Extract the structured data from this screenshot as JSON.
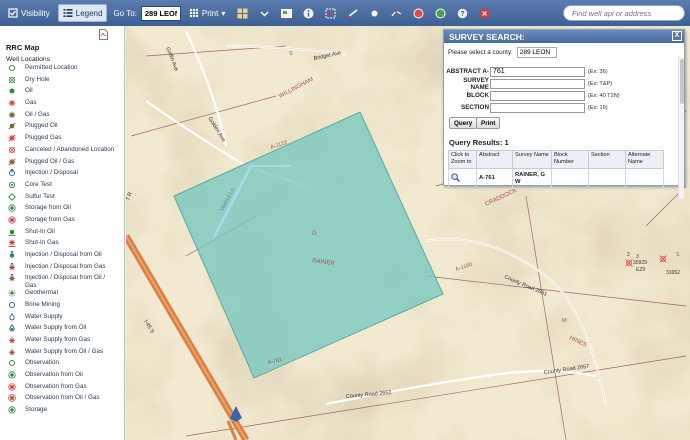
{
  "toolbar": {
    "visibility_label": "Visibility",
    "legend_label": "Legend",
    "goto_label": "Go To:",
    "goto_value": "289 LEON",
    "print_label": "Print",
    "search_placeholder": "Find well api or address"
  },
  "legend": {
    "title": "RRC Map",
    "section": "Well Locations",
    "items": [
      {
        "label": "Permitted Location",
        "icon": "circle-outline",
        "color": "#2f8a3e"
      },
      {
        "label": "Dry Hole",
        "icon": "circle-cross",
        "color": "#2f8a3e"
      },
      {
        "label": "Oil",
        "icon": "dot",
        "color": "#2f8a3e"
      },
      {
        "label": "Gas",
        "icon": "star",
        "color": "#d63b3b"
      },
      {
        "label": "Oil / Gas",
        "icon": "dot-star",
        "color": "#d63b3b"
      },
      {
        "label": "Plugged Oil",
        "icon": "dot-slash",
        "color": "#d63b3b"
      },
      {
        "label": "Plugged Gas",
        "icon": "star-slash",
        "color": "#d63b3b"
      },
      {
        "label": "Canceled / Abandoned Location",
        "icon": "circle-outline-cross",
        "color": "#d63b3b"
      },
      {
        "label": "Plugged Oil / Gas",
        "icon": "dot-star-slash",
        "color": "#d63b3b"
      },
      {
        "label": "Injection / Disposal",
        "icon": "arrow-circle",
        "color": "#2f5fb0"
      },
      {
        "label": "Core Test",
        "icon": "circle-dot",
        "color": "#2f8a3e"
      },
      {
        "label": "Sulfur Test",
        "icon": "diamond",
        "color": "#2f8a3e"
      },
      {
        "label": "Storage from Oil",
        "icon": "ring-dot",
        "color": "#2f8a3e"
      },
      {
        "label": "Storage from Gas",
        "icon": "ring-star",
        "color": "#d63b3b"
      },
      {
        "label": "Shut-In Oil",
        "icon": "dot-bar",
        "color": "#2f8a3e"
      },
      {
        "label": "Shut-In Gas",
        "icon": "star-bar",
        "color": "#d63b3b"
      },
      {
        "label": "Injection / Disposal from Oil",
        "icon": "arrow-dot",
        "color": "#2f5fb0"
      },
      {
        "label": "Injection / Disposal from Gas",
        "icon": "arrow-star",
        "color": "#d63b3b"
      },
      {
        "label": "Injection / Disposal from Oil / Gas",
        "icon": "arrow-dot-star",
        "color": "#d63b3b"
      },
      {
        "label": "Geothermal",
        "icon": "sun",
        "color": "#2f8a3e"
      },
      {
        "label": "Brine Mining",
        "icon": "circle-outline",
        "color": "#2f5fb0"
      },
      {
        "label": "Water Supply",
        "icon": "drop",
        "color": "#2f5fb0"
      },
      {
        "label": "Water Supply from Oil",
        "icon": "drop-dot",
        "color": "#2f5fb0"
      },
      {
        "label": "Water Supply from Gas",
        "icon": "drop-star",
        "color": "#d63b3b"
      },
      {
        "label": "Water Supply from Oil / Gas",
        "icon": "drop-dot-star",
        "color": "#d63b3b"
      },
      {
        "label": "Observation",
        "icon": "circle-outline",
        "color": "#2f8a3e"
      },
      {
        "label": "Observation from Oil",
        "icon": "ring-dot",
        "color": "#2f8a3e"
      },
      {
        "label": "Observation from Gas",
        "icon": "ring-star",
        "color": "#d63b3b"
      },
      {
        "label": "Observation from Oil / Gas",
        "icon": "ring-dot-star",
        "color": "#d63b3b"
      },
      {
        "label": "Storage",
        "icon": "ring-dot",
        "color": "#2f8a3e"
      }
    ]
  },
  "map": {
    "labels": {
      "bridget": "Bridget Ave",
      "griffin": "Griffin Ave",
      "golden": "Golden Ave",
      "willingham": "WILLINGHAM",
      "a1122": "A-1122",
      "walnut": "Walnut Ln",
      "rainer": "RAINER",
      "g": "G",
      "s": "S",
      "m": "M",
      "craddock": "CRADDOCK",
      "a1180": "A-1180",
      "cr2661": "County Road 2661",
      "hines": "HINES",
      "a761": "A-761",
      "i45": "I-45 S",
      "cr2657": "County Road 2657",
      "cr2652": "County Road 2652",
      "well1_num": "3",
      "well1_id": "30929",
      "well1_sub": "EZ9",
      "well2_id": "31652",
      "well3_num": "2",
      "right_s": "S",
      "tr": "T R"
    }
  },
  "dialog": {
    "title": "SURVEY SEARCH:",
    "close": "X",
    "county_label": "Please select a county:",
    "county_value": "289 LEON",
    "abstract_label": "ABSTRACT A-",
    "abstract_value": "761",
    "abstract_hint": "(Ex: 36)",
    "survey_label": "SURVEY NAME",
    "survey_value": "",
    "survey_hint": "(Ex: T&P)",
    "block_label": "BLOCK",
    "block_value": "",
    "block_hint": "(Ex: 40 T2N)",
    "section_label": "SECTION",
    "section_value": "",
    "section_hint": "(Ex: 19)",
    "query_btn": "Query",
    "print_btn": "Print",
    "results_label": "Query Results:",
    "results_count": "1",
    "columns": [
      "Click to Zoom to",
      "Abstract",
      "Survey Name",
      "Block Number",
      "Section",
      "Alternate Name"
    ],
    "row": {
      "abstract": "A-761",
      "survey_name": "RAINER, G W",
      "block": "",
      "section": "",
      "alternate": ""
    }
  }
}
